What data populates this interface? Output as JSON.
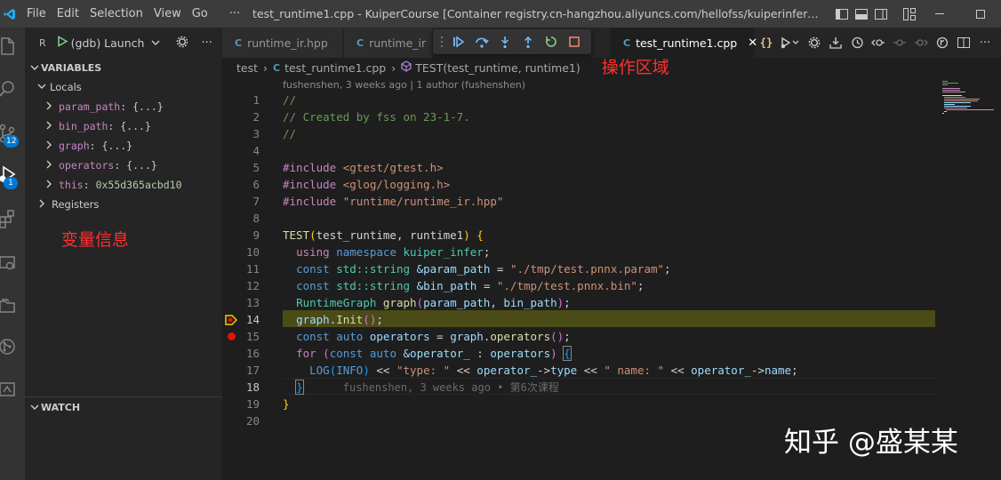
{
  "titlebar": {
    "menu": [
      "File",
      "Edit",
      "Selection",
      "View",
      "Go",
      "···"
    ],
    "title": "test_runtime1.cpp - KuiperCourse [Container registry.cn-hangzhou.aliyuncs.com/hellofss/kuiperinfer:latest (pedantic_clar..."
  },
  "activity": {
    "scm_badge": "12",
    "debug_badge": "1"
  },
  "sidebar": {
    "title": "R",
    "launch_config": "(gdb) Launch",
    "variables_header": "VARIABLES",
    "locals_label": "Locals",
    "locals": [
      {
        "name": "param_path",
        "value": "{...}"
      },
      {
        "name": "bin_path",
        "value": "{...}"
      },
      {
        "name": "graph",
        "value": "{...}"
      },
      {
        "name": "operators",
        "value": "{...}"
      },
      {
        "name": "this",
        "value": "0x55d365acbd10"
      }
    ],
    "registers_label": "Registers",
    "watch_header": "WATCH",
    "annotation_vars": "变量信息"
  },
  "tabs": [
    {
      "label": "runtime_ir.hpp",
      "icon": "C"
    },
    {
      "label": "runtime_ir",
      "icon": "C"
    },
    {
      "label": "test_runtime1.cpp",
      "icon": "C",
      "active": true
    }
  ],
  "breadcrumb": {
    "items": [
      "test",
      "test_runtime1.cpp",
      "TEST(test_runtime, runtime1)"
    ],
    "annotation_ops": "操作区域"
  },
  "editor": {
    "blame_header": "fushenshen, 3 weeks ago | 1 author (fushenshen)",
    "current_line": 18,
    "paused_line": 14,
    "breakpoint_line": 15,
    "inline_blame": "fushenshen, 3 weeks ago • 第6次课程",
    "line_numbers": [
      "1",
      "2",
      "3",
      "4",
      "5",
      "6",
      "7",
      "8",
      "9",
      "10",
      "11",
      "12",
      "13",
      "14",
      "15",
      "16",
      "17",
      "18",
      "19",
      "20"
    ],
    "code_text": {
      "l1": "//",
      "l2": "// Created by fss on 23-1-7.",
      "l3": "//",
      "inc": "#include",
      "inc1": "<gtest/gtest.h>",
      "inc2": "<glog/logging.h>",
      "inc3": "\"runtime/runtime_ir.hpp\"",
      "test": "TEST",
      "test_args": "test_runtime, runtime1",
      "using": "using",
      "namespace": "namespace",
      "ns": "kuiper_infer",
      "const": "const",
      "std_string": "std::string",
      "param_path": "&param_path",
      "param_str": "\"./tmp/test.pnnx.param\"",
      "bin_path": "&bin_path",
      "bin_str": "\"./tmp/test.pnnx.bin\"",
      "rg_type": "RuntimeGraph",
      "graph_fn": "graph",
      "arg1": "param_path",
      "arg2": "bin_path",
      "graph_var": "graph",
      "init": "Init",
      "auto": "auto",
      "operators": "operators",
      "for": "for",
      "op": "&operator_",
      "log": "LOG",
      "info": "INFO",
      "type_str": "\"type: \"",
      "op_var": "operator_",
      "type_mem": "type",
      "name_str": "\" name: \"",
      "name_mem": "name"
    }
  },
  "watermark": "知乎 @盛某某"
}
